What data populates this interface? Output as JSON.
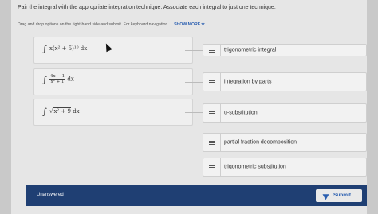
{
  "header": {
    "title": "Pair the integral with the appropriate integration technique. Associate each integral to just one technique."
  },
  "instruction": {
    "text": "Drag and drop options on the right-hand side and submit. For keyboard navigation...",
    "show_more": "SHOW MORE"
  },
  "integrals": [
    {
      "label": "x(x² + 5)¹⁰ dx"
    },
    {
      "numerator": "4x − 1",
      "denominator": "x² + 1",
      "suffix": "dx"
    },
    {
      "radicand": "x² + 9",
      "suffix": "dx"
    }
  ],
  "options": [
    {
      "label": "trigonometric integral"
    },
    {
      "label": "integration by parts"
    },
    {
      "label": "u-substitution"
    },
    {
      "label": "partial fraction decomposition"
    },
    {
      "label": "trigonometric substitution"
    }
  ],
  "footer": {
    "status": "Unanswered",
    "submit_label": "Submit"
  },
  "colors": {
    "accent": "#2b5fb0",
    "footer_bg": "#1f3f73"
  }
}
